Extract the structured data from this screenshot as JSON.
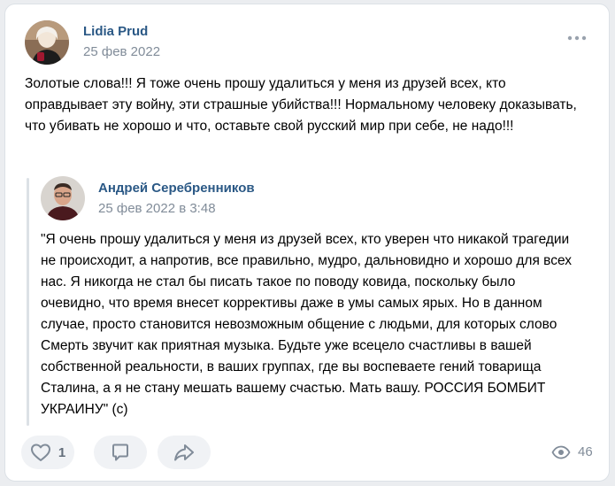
{
  "colors": {
    "link": "#2a5885",
    "muted": "#818c99",
    "button_bg": "#f0f2f5",
    "icon": "#818c99"
  },
  "post": {
    "author": "Lidia Prud",
    "date": "25 фев 2022",
    "more_icon": "ellipsis-icon",
    "text": "Золотые слова!!! Я тоже очень прошу удалиться у меня из друзей всех, кто оправдывает эту войну, эти страшные убийства!!! Нормальному человеку доказывать, что убивать не хорошо и что, оставьте свой русский мир при себе, не надо!!!"
  },
  "repost": {
    "author": "Андрей Серебренников",
    "date": "25 фев 2022 в 3:48",
    "text": "\"Я очень прошу удалиться у меня из друзей всех, кто уверен что никакой трагедии не происходит, а напротив, все правильно, мудро, дальновидно и хорошо для всех нас. Я никогда не стал бы писать такое по поводу ковида, поскольку было очевидно, что время внесет коррективы даже в умы самых ярых. Но в данном случае, просто становится невозможным общение с людьми, для которых слово Смерть звучит как приятная музыка. Будьте уже всецело счастливы в вашей собственной реальности, в ваших группах, где вы воспеваете гений товарища Сталина, а я не стану мешать вашему счастью. Мать вашу. РОССИЯ БОМБИТ УКРАИНУ\" (c)"
  },
  "actions": {
    "like_icon": "heart-icon",
    "like_count": "1",
    "comment_icon": "comment-icon",
    "share_icon": "share-icon",
    "views_icon": "eye-icon",
    "views_count": "46"
  }
}
